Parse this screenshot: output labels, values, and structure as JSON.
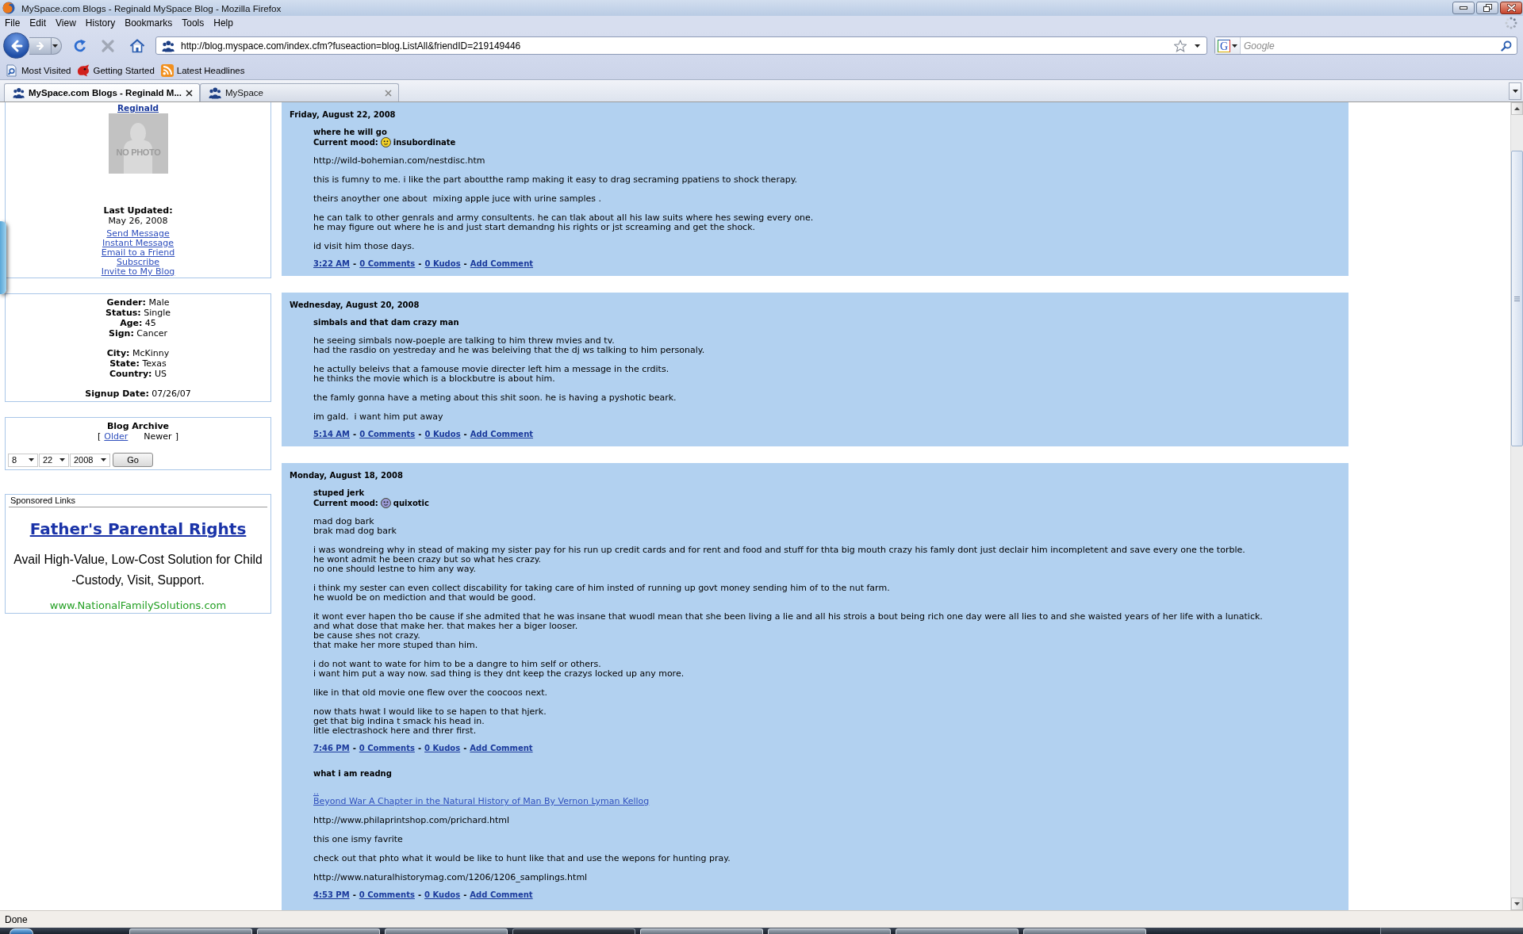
{
  "window": {
    "title": "MySpace.com Blogs - Reginald MySpace Blog - Mozilla Firefox"
  },
  "menu": [
    "File",
    "Edit",
    "View",
    "History",
    "Bookmarks",
    "Tools",
    "Help"
  ],
  "address_bar": {
    "url": "http://blog.myspace.com/index.cfm?fuseaction=blog.ListAll&friendID=219149446"
  },
  "search": {
    "engine": "G",
    "placeholder": "Google"
  },
  "bookmarks": [
    {
      "label": "Most Visited",
      "kind": "query"
    },
    {
      "label": "Getting Started",
      "kind": "page"
    },
    {
      "label": "Latest Headlines",
      "kind": "feed"
    }
  ],
  "tabs": [
    {
      "label": "MySpace.com Blogs - Reginald M...",
      "selected": true
    },
    {
      "label": "MySpace",
      "selected": false
    }
  ],
  "sidebar": {
    "profile": {
      "name": "Reginald",
      "photo_label": "NO PHOTO",
      "updated_label": "Last Updated:",
      "updated": "May 26, 2008",
      "links": [
        "Send Message",
        "Instant Message",
        "Email to a Friend",
        "Subscribe",
        "Invite to My Blog"
      ]
    },
    "details": [
      [
        "**Gender:** Male",
        "**Status:** Single",
        "**Age:** 45",
        "**Sign:** Cancer"
      ],
      [
        "**City:** McKinny",
        "**State:** Texas",
        "**Country:** US"
      ],
      [
        "**Signup Date:** 07/26/07"
      ]
    ],
    "archive": {
      "title": "Blog Archive",
      "open": "[",
      "nav": [
        {
          "label": "Older",
          "disabled": false
        },
        {
          "label": "Newer",
          "disabled": true
        }
      ],
      "close": "]",
      "selects": [
        {
          "kind": "month",
          "value": "8"
        },
        {
          "kind": "day",
          "value": "22"
        },
        {
          "kind": "year",
          "value": "2008"
        }
      ],
      "button": "Go"
    },
    "sponsored": {
      "heading": "Sponsored Links",
      "title": "Father's Parental Rights",
      "text": "Avail High-Value, Low-Cost Solution for Child -Custody, Visit, Support.",
      "url": "www.NationalFamilySolutions.com"
    }
  },
  "days": [
    {
      "date": "Friday, August 22, 2008",
      "entries": [
        {
          "title": "where he will go",
          "mood": {
            "label": "Current mood:",
            "text": "insubordinate",
            "color": "#f5d327"
          },
          "paragraphs": [
            {
              "kind": "text",
              "lines": [
                "http://wild-bohemian.com/nestdisc.htm"
              ]
            },
            {
              "kind": "text",
              "lines": [
                "this is fumny to me. i like the part aboutthe ramp making it easy to drag secraming ppatiens to shock therapy."
              ]
            },
            {
              "kind": "text",
              "lines": [
                "theirs anoyther one about  mixing apple juce with urine samples ."
              ]
            },
            {
              "kind": "text",
              "lines": [
                "he can talk to other genrals and army consultents. he can tlak about all his law suits where hes sewing every one.",
                "he may figure out where he is and just start demandng his rights or jst screaming and get the shock."
              ]
            },
            {
              "kind": "text",
              "lines": [
                "id visit him those days."
              ]
            }
          ],
          "footer": {
            "links": [
              "3:22 AM",
              "0 Comments",
              "0 Kudos",
              "Add Comment"
            ],
            "separator": "-"
          }
        }
      ]
    },
    {
      "date": "Wednesday, August 20, 2008",
      "entries": [
        {
          "title": "simbals and that dam crazy man",
          "paragraphs": [
            {
              "kind": "text",
              "lines": [
                "he seeing simbals now-poeple are talking to him threw mvies and tv.",
                "had the rasdio on yestreday and he was beleiving that the dj ws talking to him personaly."
              ]
            },
            {
              "kind": "text",
              "lines": [
                "he actully beleivs that a famouse movie directer left him a message in the crdits.",
                "he thinks the movie which is a blockbutre is about him."
              ]
            },
            {
              "kind": "text",
              "lines": [
                "the famly gonna have a meting about this shit soon. he is having a pyshotic beark."
              ]
            },
            {
              "kind": "text",
              "lines": [
                "im gald.  i want him put away"
              ]
            }
          ],
          "footer": {
            "links": [
              "5:14 AM",
              "0 Comments",
              "0 Kudos",
              "Add Comment"
            ],
            "separator": "-"
          }
        }
      ]
    },
    {
      "date": "Monday, August 18, 2008",
      "entries": [
        {
          "title": "stuped jerk",
          "mood": {
            "label": "Current mood:",
            "text": "quixotic",
            "color": "#9b9bd6"
          },
          "paragraphs": [
            {
              "kind": "text",
              "lines": [
                "mad dog bark",
                "brak mad dog bark"
              ]
            },
            {
              "kind": "text",
              "lines": [
                "i was wondreing why in stead of making my sister pay for his run up credit cards and for rent and food and stuff for thta big mouth crazy his famly dont just declair him incompletent and save every one the torble.",
                "he wont admit he been crazy but so what hes crazy.",
                "no one should lestne to him any way."
              ]
            },
            {
              "kind": "text",
              "lines": [
                "i think my sester can even collect discability for taking care of him insted of running up govt money sending him of to the nut farm.",
                "he wuold be on mediction and that would be good."
              ]
            },
            {
              "kind": "text",
              "lines": [
                "it wont ever hapen tho be cause if she admited that he was insane that wuodl mean that she been living a lie and all his strois a bout being rich one day were all lies to and she waisted years of her life with a lunatick.",
                "and what dose that make her. that makes her a biger looser.",
                "be cause shes not crazy.",
                "that make her more stuped than him."
              ]
            },
            {
              "kind": "text",
              "lines": [
                "i do not want to wate for him to be a dangre to him self or others.",
                "i want him put a way now. sad thing is they dnt keep the crazys locked up any more."
              ]
            },
            {
              "kind": "text",
              "lines": [
                "like in that old movie one flew over the coocoos next."
              ]
            },
            {
              "kind": "text",
              "lines": [
                "now thats hwat I would like to se hapen to that hjerk.",
                "get that big indina t smack his head in.",
                "litle electrashock here and threr first."
              ]
            }
          ],
          "footer": {
            "links": [
              "7:46 PM",
              "0 Comments",
              "0 Kudos",
              "Add Comment"
            ],
            "separator": "-"
          }
        },
        {
          "title": "what i am readng",
          "paragraphs": [
            {
              "kind": "link",
              "lines": [
                "..",
                "Beyond War A Chapter in the Natural History of Man By Vernon Lyman Kellog"
              ]
            },
            {
              "kind": "text",
              "lines": [
                "http://www.philaprintshop.com/prichard.html"
              ]
            },
            {
              "kind": "text",
              "lines": [
                "this one ismy favrite"
              ]
            },
            {
              "kind": "text",
              "lines": [
                "check out that phto what it would be like to hunt like that and use the wepons for hunting pray."
              ]
            },
            {
              "kind": "text",
              "lines": [
                "http://www.naturalhistorymag.com/1206/1206_samplings.html"
              ]
            }
          ],
          "footer": {
            "links": [
              "4:53 PM",
              "0 Comments",
              "0 Kudos",
              "Add Comment"
            ],
            "separator": "-"
          }
        }
      ]
    }
  ],
  "status_bar": {
    "text": "Done"
  },
  "taskbar": {
    "buttons": [
      {
        "selected": false
      },
      {
        "selected": false
      },
      {
        "selected": false
      },
      {
        "selected": true
      },
      {
        "selected": false
      },
      {
        "selected": false
      },
      {
        "selected": false
      },
      {
        "selected": false
      }
    ]
  }
}
